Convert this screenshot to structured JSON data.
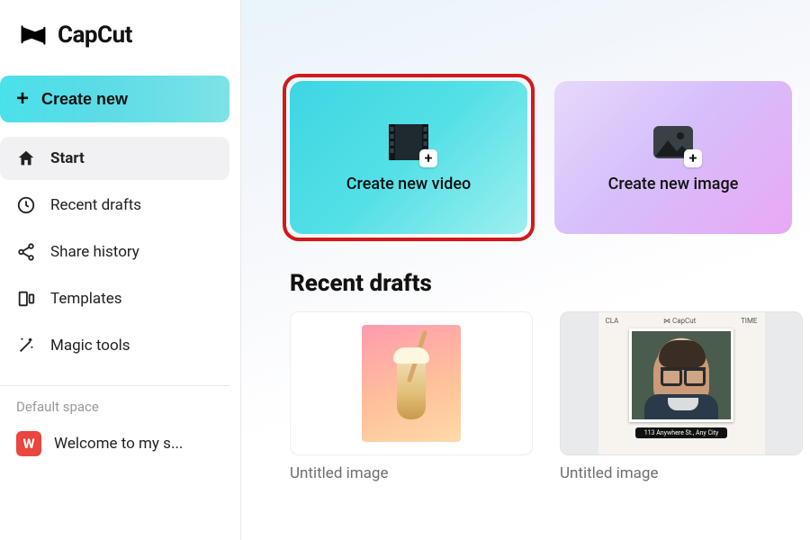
{
  "brand": {
    "name": "CapCut"
  },
  "sidebar": {
    "create_label": "Create new",
    "items": [
      {
        "label": "Start",
        "icon": "home-icon",
        "active": true
      },
      {
        "label": "Recent drafts",
        "icon": "clock-icon",
        "active": false
      },
      {
        "label": "Share history",
        "icon": "share-icon",
        "active": false
      },
      {
        "label": "Templates",
        "icon": "templates-icon",
        "active": false
      },
      {
        "label": "Magic tools",
        "icon": "magic-icon",
        "active": false
      }
    ],
    "space_section_label": "Default space",
    "space_item": {
      "avatar_letter": "W",
      "label": "Welcome to my s..."
    }
  },
  "hero": {
    "video": {
      "label": "Create new video"
    },
    "image": {
      "label": "Create new image"
    }
  },
  "recent": {
    "title": "Recent drafts",
    "drafts": [
      {
        "name": "Untitled image"
      },
      {
        "name": "Untitled image"
      }
    ]
  }
}
